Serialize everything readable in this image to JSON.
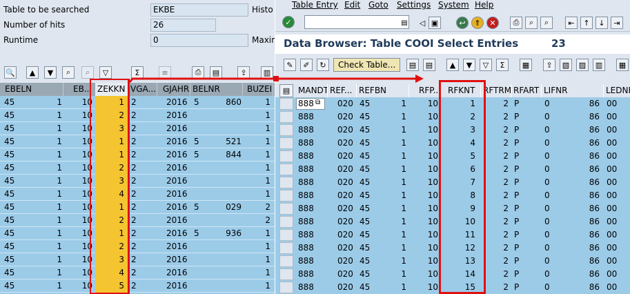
{
  "left": {
    "fields": [
      {
        "label": "Table to be searched",
        "value": "EKBE",
        "after": "Histo"
      },
      {
        "label": "Number of hits",
        "value": "26",
        "after": ""
      },
      {
        "label": "Runtime",
        "value": "0",
        "after": "Maxim"
      }
    ],
    "columns": [
      "EBELN",
      "EB..",
      "ZEKKN",
      "VGA...",
      "GJAHR",
      "BELNR",
      "BUZEI"
    ],
    "rows": [
      {
        "ebeln": "45",
        "eb1": "1",
        "eb2": "10",
        "zekkn": "1",
        "vga": "2",
        "gjahr": "2016",
        "belnr1": "5",
        "belnr2": "860",
        "buzei": "1"
      },
      {
        "ebeln": "45",
        "eb1": "1",
        "eb2": "10",
        "zekkn": "2",
        "vga": "2",
        "gjahr": "2016",
        "belnr1": "",
        "belnr2": "",
        "buzei": "1"
      },
      {
        "ebeln": "45",
        "eb1": "1",
        "eb2": "10",
        "zekkn": "3",
        "vga": "2",
        "gjahr": "2016",
        "belnr1": "",
        "belnr2": "",
        "buzei": "1"
      },
      {
        "ebeln": "45",
        "eb1": "1",
        "eb2": "10",
        "zekkn": "1",
        "vga": "2",
        "gjahr": "2016",
        "belnr1": "5",
        "belnr2": "521",
        "buzei": "1"
      },
      {
        "ebeln": "45",
        "eb1": "1",
        "eb2": "10",
        "zekkn": "1",
        "vga": "2",
        "gjahr": "2016",
        "belnr1": "5",
        "belnr2": "844",
        "buzei": "1"
      },
      {
        "ebeln": "45",
        "eb1": "1",
        "eb2": "10",
        "zekkn": "2",
        "vga": "2",
        "gjahr": "2016",
        "belnr1": "",
        "belnr2": "",
        "buzei": "1"
      },
      {
        "ebeln": "45",
        "eb1": "1",
        "eb2": "10",
        "zekkn": "3",
        "vga": "2",
        "gjahr": "2016",
        "belnr1": "",
        "belnr2": "",
        "buzei": "1"
      },
      {
        "ebeln": "45",
        "eb1": "1",
        "eb2": "10",
        "zekkn": "4",
        "vga": "2",
        "gjahr": "2016",
        "belnr1": "",
        "belnr2": "",
        "buzei": "1"
      },
      {
        "ebeln": "45",
        "eb1": "1",
        "eb2": "10",
        "zekkn": "1",
        "vga": "2",
        "gjahr": "2016",
        "belnr1": "5",
        "belnr2": "029",
        "buzei": "2"
      },
      {
        "ebeln": "45",
        "eb1": "1",
        "eb2": "10",
        "zekkn": "2",
        "vga": "2",
        "gjahr": "2016",
        "belnr1": "",
        "belnr2": "",
        "buzei": "2"
      },
      {
        "ebeln": "45",
        "eb1": "1",
        "eb2": "10",
        "zekkn": "1",
        "vga": "2",
        "gjahr": "2016",
        "belnr1": "5",
        "belnr2": "936",
        "buzei": "1"
      },
      {
        "ebeln": "45",
        "eb1": "1",
        "eb2": "10",
        "zekkn": "2",
        "vga": "2",
        "gjahr": "2016",
        "belnr1": "",
        "belnr2": "",
        "buzei": "1"
      },
      {
        "ebeln": "45",
        "eb1": "1",
        "eb2": "10",
        "zekkn": "3",
        "vga": "2",
        "gjahr": "2016",
        "belnr1": "",
        "belnr2": "",
        "buzei": "1"
      },
      {
        "ebeln": "45",
        "eb1": "1",
        "eb2": "10",
        "zekkn": "4",
        "vga": "2",
        "gjahr": "2016",
        "belnr1": "",
        "belnr2": "",
        "buzei": "1"
      },
      {
        "ebeln": "45",
        "eb1": "1",
        "eb2": "10",
        "zekkn": "5",
        "vga": "2",
        "gjahr": "2016",
        "belnr1": "",
        "belnr2": "",
        "buzei": "1"
      }
    ]
  },
  "right": {
    "menu": [
      "Table Entry",
      "Edit",
      "Goto",
      "Settings",
      "System",
      "Help"
    ],
    "title": "Data Browser: Table COOI Select Entries",
    "count": "23",
    "check_table_label": "Check Table...",
    "columns": [
      "MANDT",
      "REF...",
      "REFBN",
      "RFP...",
      "RFKNT",
      "RFTRM",
      "RFART",
      "LIFNR",
      "LEDNR"
    ],
    "rows": [
      {
        "mandt": "888",
        "ref": "020",
        "refbn": "45",
        "rfp1": "1",
        "rfp2": "10",
        "rfknt": "1",
        "rftrm": "2",
        "rfart": "P",
        "lifnr1": "0",
        "lifnr2": "86",
        "lednr": "00"
      },
      {
        "mandt": "888",
        "ref": "020",
        "refbn": "45",
        "rfp1": "1",
        "rfp2": "10",
        "rfknt": "2",
        "rftrm": "2",
        "rfart": "P",
        "lifnr1": "0",
        "lifnr2": "86",
        "lednr": "00"
      },
      {
        "mandt": "888",
        "ref": "020",
        "refbn": "45",
        "rfp1": "1",
        "rfp2": "10",
        "rfknt": "3",
        "rftrm": "2",
        "rfart": "P",
        "lifnr1": "0",
        "lifnr2": "86",
        "lednr": "00"
      },
      {
        "mandt": "888",
        "ref": "020",
        "refbn": "45",
        "rfp1": "1",
        "rfp2": "10",
        "rfknt": "4",
        "rftrm": "2",
        "rfart": "P",
        "lifnr1": "0",
        "lifnr2": "86",
        "lednr": "00"
      },
      {
        "mandt": "888",
        "ref": "020",
        "refbn": "45",
        "rfp1": "1",
        "rfp2": "10",
        "rfknt": "5",
        "rftrm": "2",
        "rfart": "P",
        "lifnr1": "0",
        "lifnr2": "86",
        "lednr": "00"
      },
      {
        "mandt": "888",
        "ref": "020",
        "refbn": "45",
        "rfp1": "1",
        "rfp2": "10",
        "rfknt": "6",
        "rftrm": "2",
        "rfart": "P",
        "lifnr1": "0",
        "lifnr2": "86",
        "lednr": "00"
      },
      {
        "mandt": "888",
        "ref": "020",
        "refbn": "45",
        "rfp1": "1",
        "rfp2": "10",
        "rfknt": "7",
        "rftrm": "2",
        "rfart": "P",
        "lifnr1": "0",
        "lifnr2": "86",
        "lednr": "00"
      },
      {
        "mandt": "888",
        "ref": "020",
        "refbn": "45",
        "rfp1": "1",
        "rfp2": "10",
        "rfknt": "8",
        "rftrm": "2",
        "rfart": "P",
        "lifnr1": "0",
        "lifnr2": "86",
        "lednr": "00"
      },
      {
        "mandt": "888",
        "ref": "020",
        "refbn": "45",
        "rfp1": "1",
        "rfp2": "10",
        "rfknt": "9",
        "rftrm": "2",
        "rfart": "P",
        "lifnr1": "0",
        "lifnr2": "86",
        "lednr": "00"
      },
      {
        "mandt": "888",
        "ref": "020",
        "refbn": "45",
        "rfp1": "1",
        "rfp2": "10",
        "rfknt": "10",
        "rftrm": "2",
        "rfart": "P",
        "lifnr1": "0",
        "lifnr2": "86",
        "lednr": "00"
      },
      {
        "mandt": "888",
        "ref": "020",
        "refbn": "45",
        "rfp1": "1",
        "rfp2": "10",
        "rfknt": "11",
        "rftrm": "2",
        "rfart": "P",
        "lifnr1": "0",
        "lifnr2": "86",
        "lednr": "00"
      },
      {
        "mandt": "888",
        "ref": "020",
        "refbn": "45",
        "rfp1": "1",
        "rfp2": "10",
        "rfknt": "12",
        "rftrm": "2",
        "rfart": "P",
        "lifnr1": "0",
        "lifnr2": "86",
        "lednr": "00"
      },
      {
        "mandt": "888",
        "ref": "020",
        "refbn": "45",
        "rfp1": "1",
        "rfp2": "10",
        "rfknt": "13",
        "rftrm": "2",
        "rfart": "P",
        "lifnr1": "0",
        "lifnr2": "86",
        "lednr": "00"
      },
      {
        "mandt": "888",
        "ref": "020",
        "refbn": "45",
        "rfp1": "1",
        "rfp2": "10",
        "rfknt": "14",
        "rftrm": "2",
        "rfart": "P",
        "lifnr1": "0",
        "lifnr2": "86",
        "lednr": "00"
      },
      {
        "mandt": "888",
        "ref": "020",
        "refbn": "45",
        "rfp1": "1",
        "rfp2": "10",
        "rfknt": "15",
        "rftrm": "2",
        "rfart": "P",
        "lifnr1": "0",
        "lifnr2": "86",
        "lednr": "00"
      }
    ]
  },
  "colors": {
    "highlight": "#f5c431",
    "grid": "#9ccbe8",
    "annotation": "#e01010"
  }
}
